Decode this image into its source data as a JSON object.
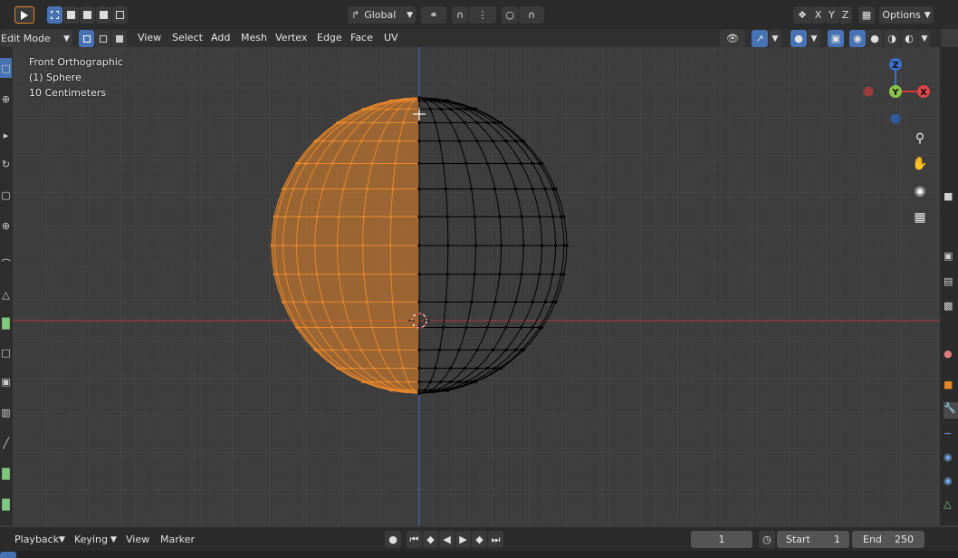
{
  "header": {
    "transform_orientation": "Global",
    "axes": [
      "X",
      "Y",
      "Z"
    ],
    "options_label": "Options"
  },
  "editor": {
    "mode": "Edit Mode",
    "menus": [
      "View",
      "Select",
      "Add",
      "Mesh",
      "Vertex",
      "Edge",
      "Face",
      "UV"
    ]
  },
  "viewport": {
    "view_name": "Front Orthographic",
    "object_name": "(1) Sphere",
    "grid_scale": "10 Centimeters"
  },
  "gizmo": {
    "z": "Z",
    "y": "Y",
    "x": "X"
  },
  "timeline": {
    "menus": [
      "Playback",
      "Keying",
      "View",
      "Marker"
    ],
    "current_frame": "1",
    "start_label": "Start",
    "start_value": "1",
    "end_label": "End",
    "end_value": "250"
  },
  "colors": {
    "selected": "#e8872a",
    "wire": "#000000",
    "x_axis": "#b33a3a",
    "z_axis": "#3b6fc9"
  }
}
